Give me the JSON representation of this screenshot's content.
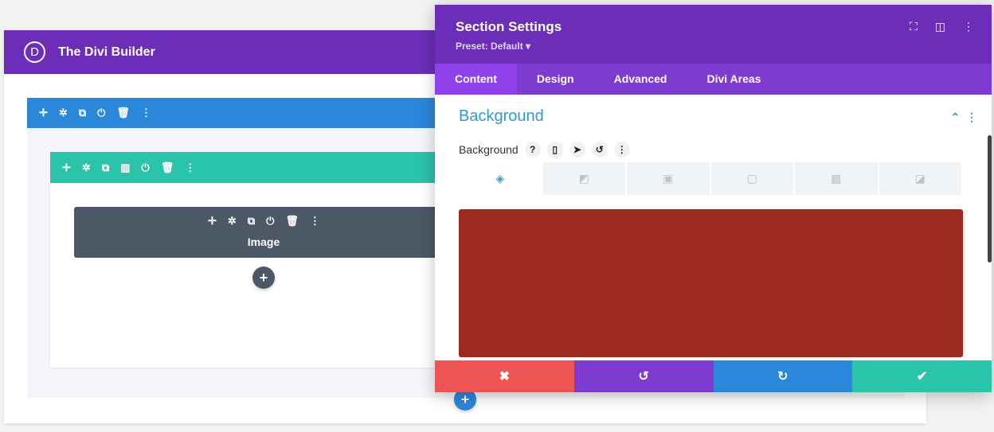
{
  "builder": {
    "logo_letter": "D",
    "title": "The Divi Builder"
  },
  "section_toolbar": {
    "icons": [
      "move-icon",
      "gear-icon",
      "duplicate-icon",
      "power-icon",
      "trash-icon",
      "more-icon"
    ]
  },
  "row_toolbar": {
    "icons": [
      "move-icon",
      "gear-icon",
      "duplicate-icon",
      "columns-icon",
      "power-icon",
      "trash-icon",
      "more-icon"
    ]
  },
  "module": {
    "label": "Image",
    "icons": [
      "move-icon",
      "gear-icon",
      "duplicate-icon",
      "power-icon",
      "trash-icon",
      "more-icon"
    ]
  },
  "add_module_symbol": "+",
  "add_row_symbol": "+",
  "panel": {
    "title": "Section Settings",
    "preset": "Preset: Default ▾",
    "header_icons": [
      "focus-icon",
      "split-view-icon",
      "more-icon"
    ],
    "tabs": [
      {
        "label": "Content",
        "active": true
      },
      {
        "label": "Design"
      },
      {
        "label": "Advanced"
      },
      {
        "label": "Divi Areas"
      }
    ],
    "group_title": "Background",
    "field_label": "Background",
    "field_icons": [
      "help-icon",
      "mobile-icon",
      "hover-cursor-icon",
      "reset-icon",
      "more-icon"
    ],
    "bg_types": [
      "color-icon",
      "gradient-icon",
      "image-icon",
      "video-icon",
      "pattern-icon",
      "mask-icon"
    ],
    "bg_color": "#9c2a20",
    "footer": {
      "cancel": "✖",
      "undo": "↺",
      "redo": "↻",
      "save": "✔"
    }
  },
  "colors": {
    "purple": "#6c2eb9",
    "section_blue": "#2b87da",
    "row_green": "#29c4a9",
    "module_gray": "#4c5866",
    "cancel_red": "#ef5555",
    "undo_purple": "#7e3bd0",
    "redo_blue": "#2b87da",
    "save_green": "#29c4a9"
  }
}
